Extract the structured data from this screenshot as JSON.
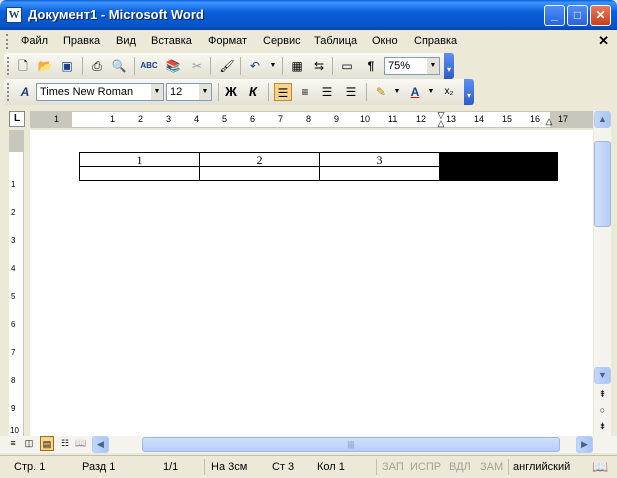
{
  "window": {
    "title": "Документ1 - Microsoft Word",
    "app_icon_letter": "W"
  },
  "title_buttons": {
    "minimize": "_",
    "maximize": "□",
    "close": "✕"
  },
  "menu": {
    "items": [
      "Файл",
      "Правка",
      "Вид",
      "Вставка",
      "Формат",
      "Сервис",
      "Таблица",
      "Окно",
      "Справка"
    ],
    "close_symbol": "✕"
  },
  "standard_toolbar": {
    "icons": [
      "new-document-icon",
      "open-folder-icon",
      "save-icon",
      "print-icon",
      "print-preview-icon",
      "spelling-icon",
      "research-icon",
      "cut-icon",
      "format-painter-icon",
      "undo-icon",
      "insert-table-icon",
      "columns-icon",
      "drawing-icon",
      "show-formatting-icon"
    ],
    "zoom": "75%"
  },
  "formatting_toolbar": {
    "style_symbol": "A",
    "font_name": "Times New Roman",
    "font_size": "12",
    "bold": "Ж",
    "italic": "К",
    "font_color_letter": "A",
    "subscript": "x₂"
  },
  "ruler": {
    "tab_selector": "L",
    "numbers": [
      "1",
      "1",
      "2",
      "3",
      "4",
      "5",
      "6",
      "7",
      "8",
      "9",
      "10",
      "11",
      "12",
      "13",
      "14",
      "15",
      "16",
      "17"
    ],
    "vertical_numbers": [
      "1",
      "2",
      "3",
      "4",
      "5",
      "6",
      "7",
      "8",
      "9",
      "10"
    ]
  },
  "document": {
    "table": {
      "rows": [
        [
          "1",
          "2",
          "3",
          ""
        ],
        [
          "",
          "",
          "",
          ""
        ]
      ]
    }
  },
  "colors": {
    "title_blue": "#0a5fd8",
    "chrome": "#ece9d8",
    "selection": "#000000"
  },
  "statusbar": {
    "page": "Стр. 1",
    "section": "Разд 1",
    "pages": "1/1",
    "position": "На 3см",
    "line": "Ст 3",
    "column": "Кол 1",
    "rec": "ЗАП",
    "trk": "ИСПР",
    "ext": "ВДЛ",
    "ovr": "ЗАМ",
    "language": "английский"
  }
}
